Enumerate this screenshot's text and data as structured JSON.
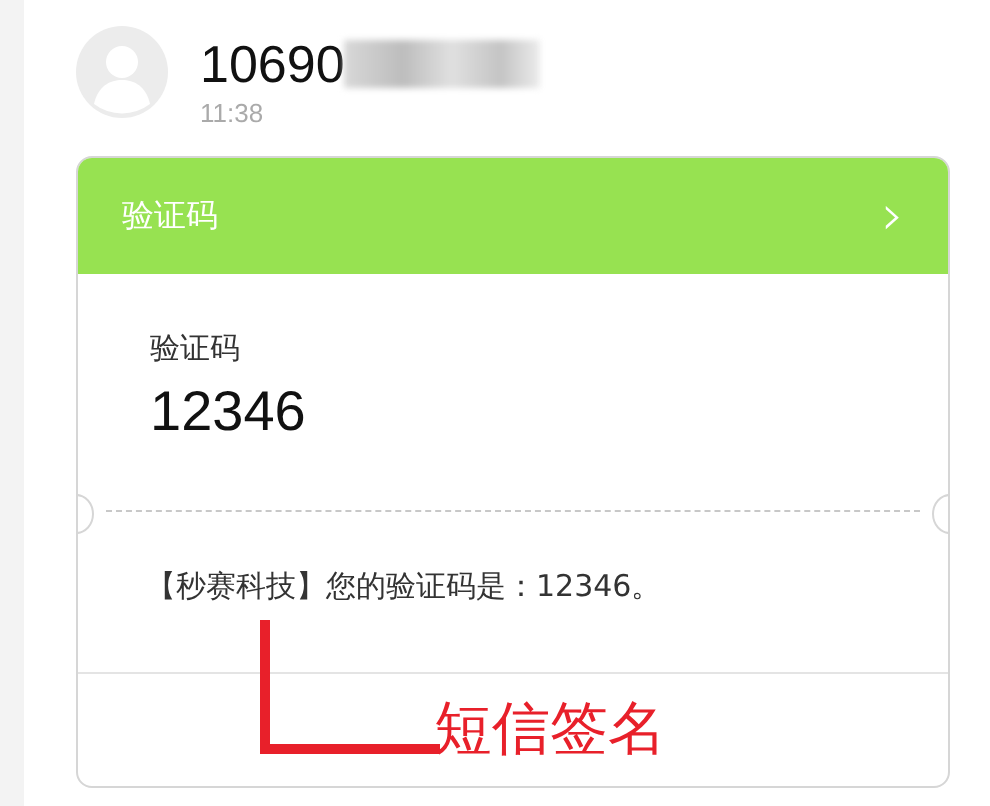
{
  "sender": {
    "number": "10690",
    "number_redacted": true,
    "time": "11:38"
  },
  "card": {
    "title": "验证码",
    "chevron": "›",
    "label": "验证码",
    "code": "12346",
    "message": "【秒赛科技】您的验证码是：12346。"
  },
  "annotation": {
    "text": "短信签名"
  }
}
